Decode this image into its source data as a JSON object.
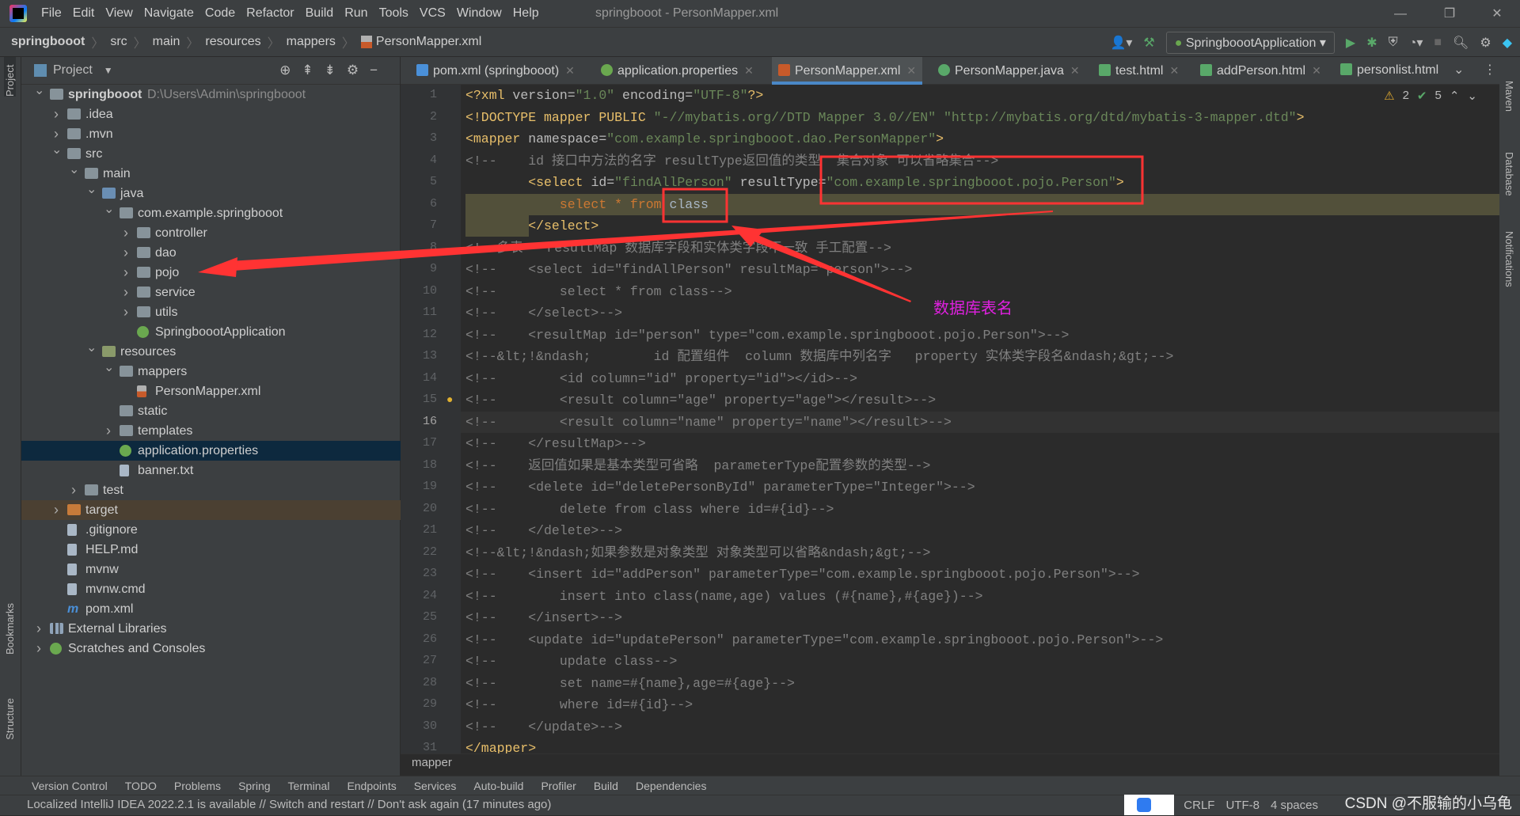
{
  "window": {
    "title": "springbooot - PersonMapper.xml",
    "controls": [
      "—",
      "❐",
      "✕"
    ]
  },
  "menu": [
    "File",
    "Edit",
    "View",
    "Navigate",
    "Code",
    "Refactor",
    "Build",
    "Run",
    "Tools",
    "VCS",
    "Window",
    "Help"
  ],
  "breadcrumb": [
    "springbooot",
    "src",
    "main",
    "resources",
    "mappers",
    "PersonMapper.xml"
  ],
  "run_config": "SpringboootApplication",
  "project_panel": {
    "title": "Project",
    "tree": [
      {
        "label": "springbooot",
        "path": "D:\\Users\\Admin\\springbooot",
        "depth": 0,
        "state": "open",
        "icon": "module"
      },
      {
        "label": ".idea",
        "depth": 1,
        "state": "closed",
        "icon": "folder"
      },
      {
        "label": ".mvn",
        "depth": 1,
        "state": "closed",
        "icon": "folder"
      },
      {
        "label": "src",
        "depth": 1,
        "state": "open",
        "icon": "folder"
      },
      {
        "label": "main",
        "depth": 2,
        "state": "open",
        "icon": "folder"
      },
      {
        "label": "java",
        "depth": 3,
        "state": "open",
        "icon": "src"
      },
      {
        "label": "com.example.springbooot",
        "depth": 4,
        "state": "open",
        "icon": "folder"
      },
      {
        "label": "controller",
        "depth": 5,
        "state": "closed",
        "icon": "folder"
      },
      {
        "label": "dao",
        "depth": 5,
        "state": "closed",
        "icon": "folder"
      },
      {
        "label": "pojo",
        "depth": 5,
        "state": "closed",
        "icon": "folder"
      },
      {
        "label": "service",
        "depth": 5,
        "state": "closed",
        "icon": "folder"
      },
      {
        "label": "utils",
        "depth": 5,
        "state": "closed",
        "icon": "folder"
      },
      {
        "label": "SpringboootApplication",
        "depth": 5,
        "state": "none",
        "icon": "spring"
      },
      {
        "label": "resources",
        "depth": 3,
        "state": "open",
        "icon": "res"
      },
      {
        "label": "mappers",
        "depth": 4,
        "state": "open",
        "icon": "folder"
      },
      {
        "label": "PersonMapper.xml",
        "depth": 5,
        "state": "none",
        "icon": "xml"
      },
      {
        "label": "static",
        "depth": 4,
        "state": "none",
        "icon": "folder"
      },
      {
        "label": "templates",
        "depth": 4,
        "state": "closed",
        "icon": "folder"
      },
      {
        "label": "application.properties",
        "depth": 4,
        "state": "none",
        "icon": "spring",
        "selected": true
      },
      {
        "label": "banner.txt",
        "depth": 4,
        "state": "none",
        "icon": "file"
      },
      {
        "label": "test",
        "depth": 2,
        "state": "closed",
        "icon": "folder"
      },
      {
        "label": "target",
        "depth": 1,
        "state": "closed",
        "icon": "excl",
        "excluded": true
      },
      {
        "label": ".gitignore",
        "depth": 1,
        "state": "none",
        "icon": "file"
      },
      {
        "label": "HELP.md",
        "depth": 1,
        "state": "none",
        "icon": "file"
      },
      {
        "label": "mvnw",
        "depth": 1,
        "state": "none",
        "icon": "file"
      },
      {
        "label": "mvnw.cmd",
        "depth": 1,
        "state": "none",
        "icon": "file"
      },
      {
        "label": "pom.xml",
        "depth": 1,
        "state": "none",
        "icon": "m"
      },
      {
        "label": "External Libraries",
        "depth": 0,
        "state": "closed",
        "icon": "lib"
      },
      {
        "label": "Scratches and Consoles",
        "depth": 0,
        "state": "closed",
        "icon": "spring"
      }
    ]
  },
  "tabs": [
    {
      "label": "pom.xml (springbooot)",
      "icon": "maven"
    },
    {
      "label": "application.properties",
      "icon": "spring"
    },
    {
      "label": "PersonMapper.xml",
      "icon": "xml",
      "active": true
    },
    {
      "label": "PersonMapper.java",
      "icon": "interface"
    },
    {
      "label": "test.html",
      "icon": "html"
    },
    {
      "label": "addPerson.html",
      "icon": "html"
    },
    {
      "label": "personlist.html",
      "icon": "html"
    }
  ],
  "inspections": {
    "warnings": "2",
    "ok": "5"
  },
  "editor": {
    "current_line": 16,
    "lines": [
      [
        [
          "<?xml ",
          "tag"
        ],
        [
          "version=",
          "attr"
        ],
        [
          "\"1.0\"",
          "val"
        ],
        [
          " encoding=",
          "attr"
        ],
        [
          "\"UTF-8\"",
          "val"
        ],
        [
          "?>",
          "tag"
        ]
      ],
      [
        [
          "<!DOCTYPE mapper PUBLIC ",
          "tag"
        ],
        [
          "\"-//mybatis.org//DTD Mapper 3.0//EN\" \"http://mybatis.org/dtd/mybatis-3-mapper.dtd\"",
          "val"
        ],
        [
          ">",
          "tag"
        ]
      ],
      [
        [
          "<mapper ",
          "tag"
        ],
        [
          "namespace=",
          "attr"
        ],
        [
          "\"com.example.springbooot.dao.PersonMapper\"",
          "val"
        ],
        [
          ">",
          "tag"
        ]
      ],
      [
        [
          "<!--    id 接口中方法的名字 resultType返回值的类型  集合对象 可以省略集合-->",
          "com"
        ]
      ],
      [
        [
          "        <select ",
          "tag"
        ],
        [
          "id=",
          "attr"
        ],
        [
          "\"findAllPerson\"",
          "val"
        ],
        [
          " resultType=",
          "attr"
        ],
        [
          "\"com.example.springbooot.pojo.Person\"",
          "val"
        ],
        [
          ">",
          "tag"
        ]
      ],
      [
        [
          "            select * from ",
          "kw"
        ],
        [
          "class",
          "txt"
        ]
      ],
      [
        [
          "        </select>",
          "tag"
        ]
      ],
      [
        [
          "<!--多表   resultMap 数据库字段和实体类字段不一致 手工配置-->",
          "com"
        ]
      ],
      [
        [
          "<!--    <select id=\"findAllPerson\" resultMap=\"person\">-->",
          "com"
        ]
      ],
      [
        [
          "<!--        select * from class-->",
          "com"
        ]
      ],
      [
        [
          "<!--    </select>-->",
          "com"
        ]
      ],
      [
        [
          "<!--    <resultMap id=\"person\" type=\"com.example.springbooot.pojo.Person\">-->",
          "com"
        ]
      ],
      [
        [
          "<!--&lt;!&ndash;        id 配置组件  column 数据库中列名字   property 实体类字段名&ndash;&gt;-->",
          "com"
        ]
      ],
      [
        [
          "<!--        <id column=\"id\" property=\"id\"></id>-->",
          "com"
        ]
      ],
      [
        [
          "<!--        <result column=\"age\" property=\"age\"></result>-->",
          "com"
        ]
      ],
      [
        [
          "<!--        <result column=\"name\" property=\"name\"></result>-->",
          "com"
        ]
      ],
      [
        [
          "<!--    </resultMap>-->",
          "com"
        ]
      ],
      [
        [
          "<!--    返回值如果是基本类型可省略  parameterType配置参数的类型-->",
          "com"
        ]
      ],
      [
        [
          "<!--    <delete id=\"deletePersonById\" parameterType=\"Integer\">-->",
          "com"
        ]
      ],
      [
        [
          "<!--        delete from class where id=#{id}-->",
          "com"
        ]
      ],
      [
        [
          "<!--    </delete>-->",
          "com"
        ]
      ],
      [
        [
          "<!--&lt;!&ndash;如果参数是对象类型 对象类型可以省略&ndash;&gt;-->",
          "com"
        ]
      ],
      [
        [
          "<!--    <insert id=\"addPerson\" parameterType=\"com.example.springbooot.pojo.Person\">-->",
          "com"
        ]
      ],
      [
        [
          "<!--        insert into class(name,age) values (#{name},#{age})-->",
          "com"
        ]
      ],
      [
        [
          "<!--    </insert>-->",
          "com"
        ]
      ],
      [
        [
          "<!--    <update id=\"updatePerson\" parameterType=\"com.example.springbooot.pojo.Person\">-->",
          "com"
        ]
      ],
      [
        [
          "<!--        update class-->",
          "com"
        ]
      ],
      [
        [
          "<!--        set name=#{name},age=#{age}-->",
          "com"
        ]
      ],
      [
        [
          "<!--        where id=#{id}-->",
          "com"
        ]
      ],
      [
        [
          "<!--    </update>-->",
          "com"
        ]
      ],
      [
        [
          "</mapper>",
          "tag"
        ]
      ]
    ],
    "breadcrumb": "mapper"
  },
  "annotation": {
    "label": "数据库表名",
    "color": "#e020e0",
    "box_color": "#ff3333"
  },
  "left_strip": [
    "Project",
    "Bookmarks",
    "Structure"
  ],
  "right_strip": [
    "Maven",
    "Database",
    "Notifications"
  ],
  "tool_windows": [
    "Version Control",
    "TODO",
    "Problems",
    "Spring",
    "Terminal",
    "Endpoints",
    "Services",
    "Auto-build",
    "Profiler",
    "Build",
    "Dependencies"
  ],
  "status": {
    "message": "Localized IntelliJ IDEA 2022.2.1 is available // Switch and restart // Don't ask again (17 minutes ago)",
    "line_sep": "CRLF",
    "encoding": "UTF-8",
    "indent": "4 spaces"
  },
  "watermark": "CSDN @不服输的小乌龟"
}
